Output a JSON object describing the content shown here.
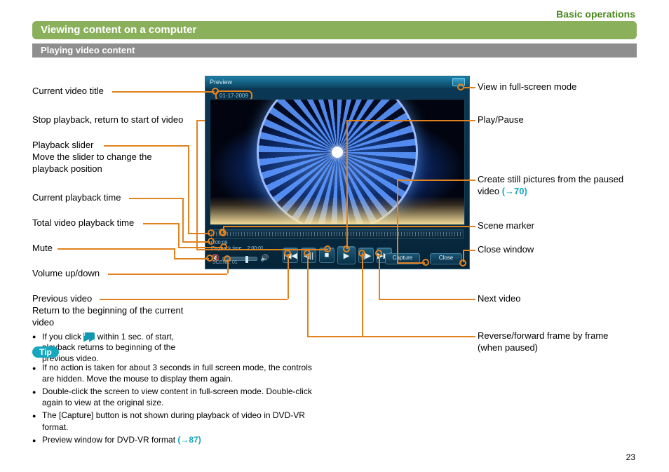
{
  "breadcrumb": "Basic operations",
  "page_title": "Viewing content on a computer",
  "subtitle": "Playing video content",
  "preview": {
    "header": "Preview",
    "video_title": "01-17-2009",
    "current_time": "0:00:09",
    "total_time_label": "Playback time",
    "total_time": "2:00:01",
    "scene_label": "SCENE: 01",
    "capture": "Capture",
    "close": "Close"
  },
  "icons": {
    "prev": "|◀◀",
    "frame_back": "◀||",
    "stop": "■",
    "play": "▶",
    "frame_fwd": "||▶",
    "next": "▶▶|",
    "mute": "🔇",
    "vol": "🔊",
    "inline_prev": "|◀◀"
  },
  "callouts": {
    "title": "Current video title",
    "stop": "Stop playback, return to start of video",
    "slider_head": "Playback slider",
    "slider_desc": "Move the slider to change the playback position",
    "cur_time": "Current playback time",
    "total_time": "Total video playback time",
    "mute": "Mute",
    "volume": "Volume up/down",
    "prev_head": "Previous video",
    "prev_desc": "Return to the beginning of the current video",
    "prev_note_a": "If you click ",
    "prev_note_b": " within 1 sec. of start, playback returns to beginning of the previous video.",
    "fullscreen": "View in full-screen mode",
    "playpause": "Play/Pause",
    "still_a": "Create still pictures from the paused video ",
    "still_link": "(→70)",
    "scene": "Scene marker",
    "closew": "Close window",
    "next": "Next video",
    "frames": "Reverse/forward frame by frame (when paused)"
  },
  "tip_label": "Tip",
  "tips": {
    "a": "If no action is taken for about 3 seconds in full screen mode, the controls are hidden. Move the mouse to display them again.",
    "b": "Double-click the screen to view content in full-screen mode. Double-click again to view at the original size.",
    "c": "The [Capture] button is not shown during playback of video in DVD-VR format.",
    "d_a": "Preview window for DVD-VR format ",
    "d_link": "(→87)"
  },
  "page_number": "23"
}
